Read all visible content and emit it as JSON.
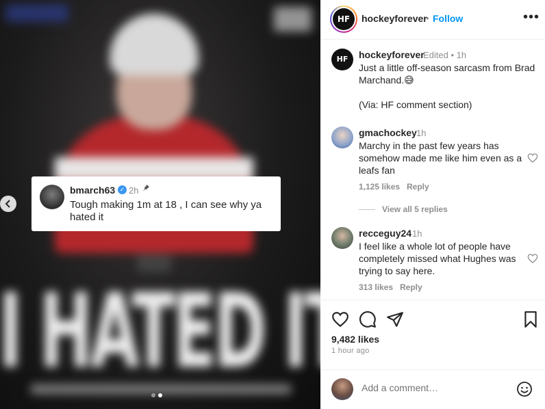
{
  "media": {
    "headline": "I HATED IT",
    "pinned_comment": {
      "username": "bmarch63",
      "time": "2h",
      "text": "Tough making 1m at 18 , I can see why ya hated it"
    }
  },
  "header": {
    "avatar_text": "HF",
    "username": "hockeyforever",
    "separator": "•",
    "follow_label": "Follow",
    "more_label": "•••"
  },
  "caption": {
    "avatar_text": "HF",
    "username": "hockeyforever",
    "meta": "Edited  •  1h",
    "text_line1": "Just a little off-season sarcasm from Brad Marchand.😅",
    "text_line2": "(Via: HF comment section)"
  },
  "comments": [
    {
      "username": "gmachockey",
      "time": "1h",
      "text": "Marchy in the past few years has somehow made me like him even as a leafs fan",
      "likes": "1,125 likes",
      "reply_label": "Reply",
      "view_replies": "View all 5 replies"
    },
    {
      "username": "recceguy24",
      "time": "1h",
      "text": "I feel like a whole lot of people have completely missed what Hughes was trying to say here.",
      "likes": "313 likes",
      "reply_label": "Reply"
    }
  ],
  "post": {
    "likes": "9,482 likes",
    "time_ago": "1 hour ago"
  },
  "add_comment": {
    "placeholder": "Add a comment…"
  },
  "carousel": {
    "slides": 2,
    "active": 2
  },
  "colors": {
    "link": "#0095f6",
    "verified": "#3897f0",
    "muted": "#8e8e8e"
  },
  "icons": [
    "chevron-left-icon",
    "pin-icon",
    "verified-icon",
    "more-icon",
    "heart-icon",
    "comment-icon",
    "share-icon",
    "bookmark-icon",
    "emoji-icon"
  ]
}
